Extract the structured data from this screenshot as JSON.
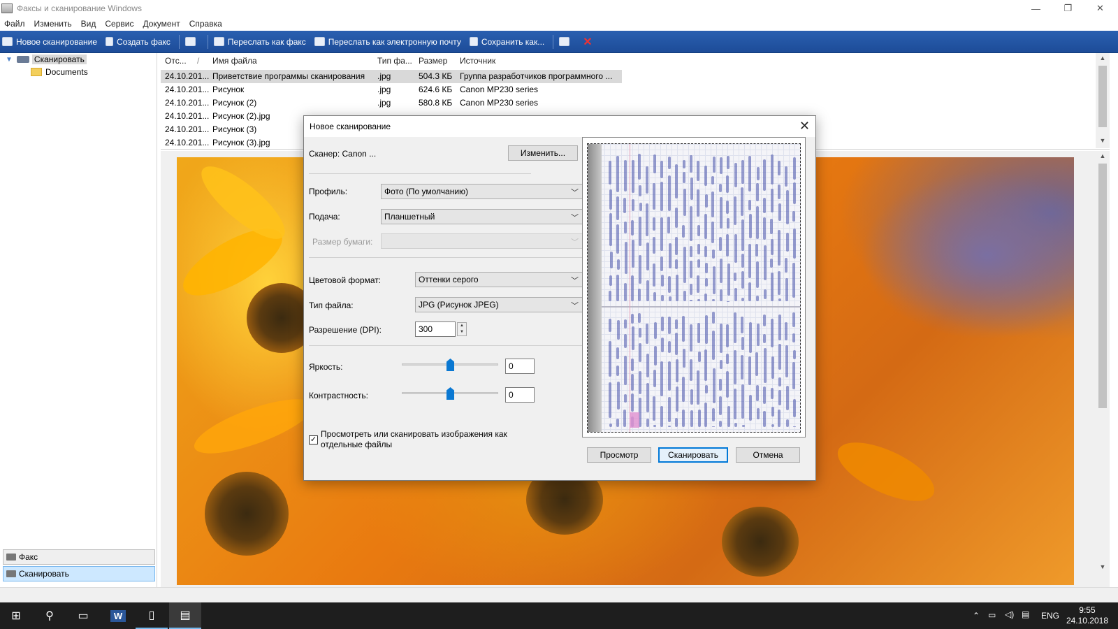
{
  "window": {
    "title": "Факсы и сканирование Windows"
  },
  "menu": [
    "Файл",
    "Изменить",
    "Вид",
    "Сервис",
    "Документ",
    "Справка"
  ],
  "toolbar": {
    "new_scan": "Новое сканирование",
    "new_fax": "Создать факс",
    "forward_fax": "Переслать как факс",
    "forward_email": "Переслать как электронную почту",
    "save_as": "Сохранить как..."
  },
  "tree": {
    "root": "Сканировать",
    "child": "Documents"
  },
  "nav": {
    "fax": "Факс",
    "scan": "Сканировать"
  },
  "filelist": {
    "columns": [
      "Отс...",
      "Имя файла",
      "Тип фа...",
      "Размер",
      "Источник"
    ],
    "rows": [
      {
        "date": "24.10.201...",
        "name": "Приветствие программы сканирования",
        "type": ".jpg",
        "size": "504.3 КБ",
        "source": "Группа разработчиков программного ..."
      },
      {
        "date": "24.10.201...",
        "name": "Рисунок",
        "type": ".jpg",
        "size": "624.6 КБ",
        "source": "Canon MP230 series"
      },
      {
        "date": "24.10.201...",
        "name": "Рисунок (2)",
        "type": ".jpg",
        "size": "580.8 КБ",
        "source": "Canon MP230 series"
      },
      {
        "date": "24.10.201...",
        "name": "Рисунок (2).jpg",
        "type": "",
        "size": "",
        "source": ""
      },
      {
        "date": "24.10.201...",
        "name": "Рисунок (3)",
        "type": "",
        "size": "",
        "source": ""
      },
      {
        "date": "24.10.201...",
        "name": "Рисунок (3).jpg",
        "type": "",
        "size": "",
        "source": ""
      }
    ]
  },
  "dialog": {
    "title": "Новое сканирование",
    "scanner_label": "Сканер: Canon ...",
    "change_button": "Изменить...",
    "profile_label": "Профиль:",
    "profile_value": "Фото (По умолчанию)",
    "source_label": "Подача:",
    "source_value": "Планшетный",
    "paper_label": "Размер бумаги:",
    "color_label": "Цветовой формат:",
    "color_value": "Оттенки серого",
    "filetype_label": "Тип файла:",
    "filetype_value": "JPG (Рисунок JPEG)",
    "dpi_label": "Разрешение (DPI):",
    "dpi_value": "300",
    "brightness_label": "Яркость:",
    "brightness_value": "0",
    "contrast_label": "Контрастность:",
    "contrast_value": "0",
    "separate_files_label": "Просмотреть или сканировать изображения как отдельные файлы",
    "separate_files_checked": true,
    "preview_button": "Просмотр",
    "scan_button": "Сканировать",
    "cancel_button": "Отмена"
  },
  "taskbar": {
    "lang": "ENG",
    "time": "9:55",
    "date": "24.10.2018"
  },
  "colors": {
    "toolbar": "#2a5fb0",
    "accent": "#0078d7"
  }
}
